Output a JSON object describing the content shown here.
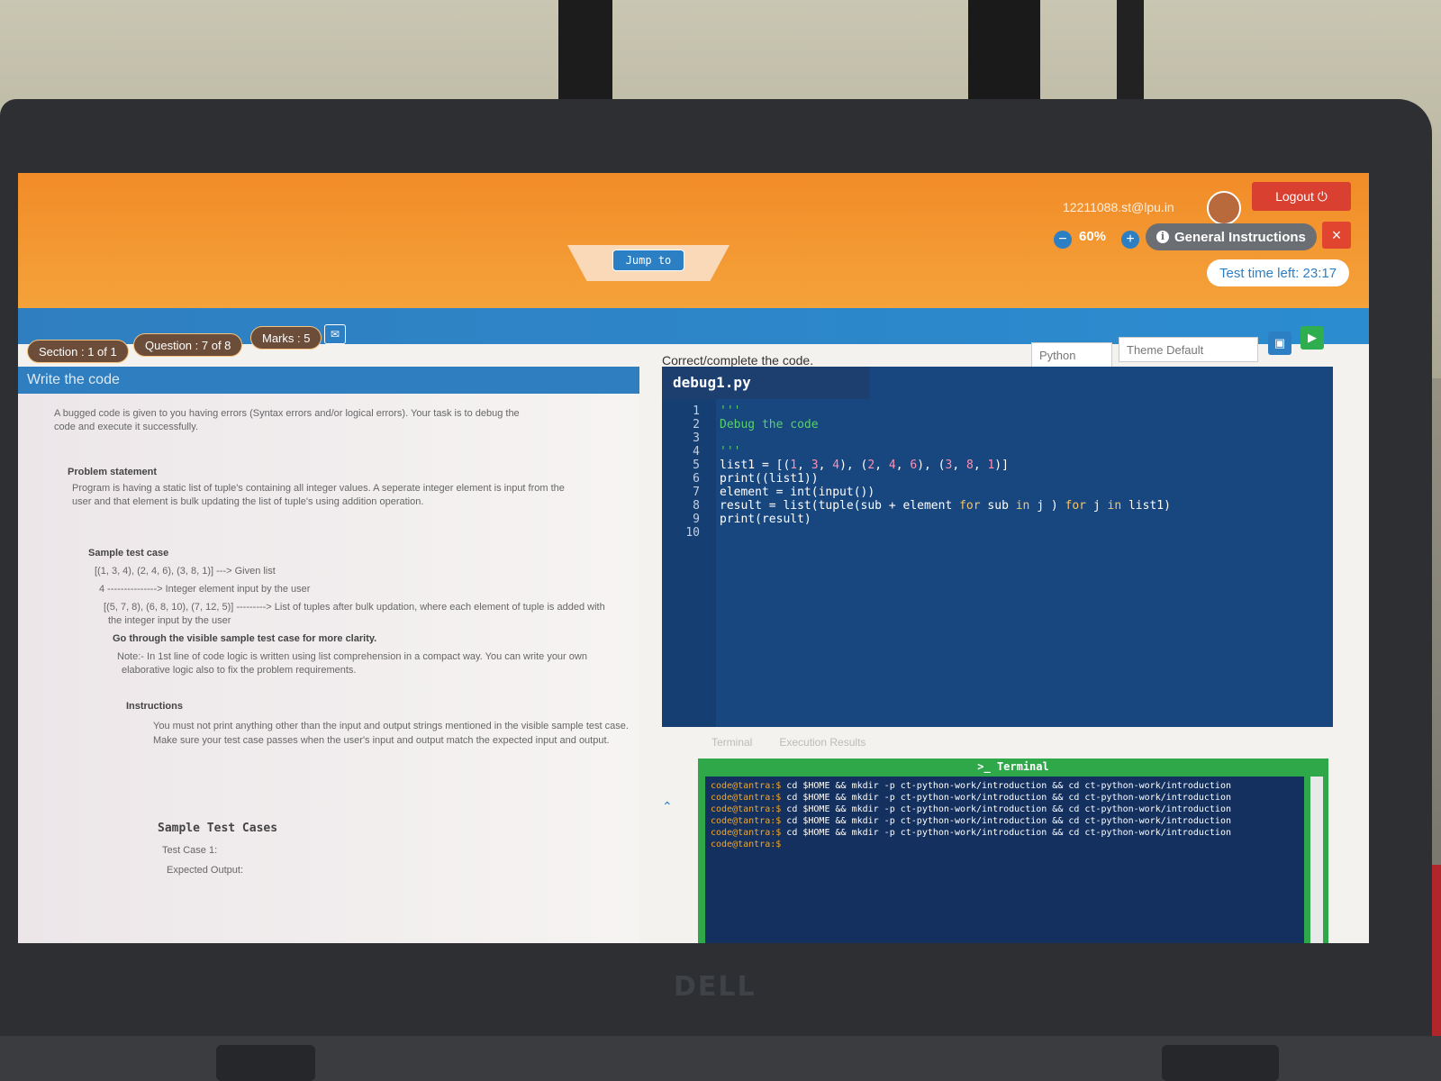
{
  "header": {
    "jump_label": "Jump to",
    "user_email": "12211088.st@lpu.in",
    "logout_label": "Logout ⏻",
    "zoom_out_symbol": "−",
    "zoom_level": "60%",
    "zoom_in_symbol": "+",
    "general_instructions_label": "General Instructions",
    "close_symbol": "×",
    "timer_text": "Test time left: 23:17"
  },
  "info_bar": {
    "section": "Section : 1 of 1",
    "question": "Question : 7 of 8",
    "marks": "Marks : 5"
  },
  "problem": {
    "title": "Write the code",
    "intro_line1": "A bugged code is given to you having errors (Syntax errors and/or logical errors). Your task is to debug the",
    "intro_line2": "code and execute it successfully.",
    "statement_heading": "Problem statement",
    "statement_line1": "Program is having a static list of tuple's containing all integer values. A seperate integer element is input from the",
    "statement_line2": "user and that element is bulk updating the list of tuple's using addition operation.",
    "sample_heading": "Sample test case",
    "sample_line1": "[(1, 3, 4), (2, 4, 6), (3, 8, 1)] ---> Given list",
    "sample_line2": "4 ---------------> Integer element input by the user",
    "sample_line3": "[(5, 7, 8), (6, 8, 10), (7, 12, 5)] ---------> List of tuples after bulk updation, where each element of tuple is added with",
    "sample_line4": "the integer input by the user",
    "visible_hint": "Go through the visible sample test case for more clarity.",
    "note_line1": "Note:- In 1st line of code logic is written using list comprehension in a compact way. You can write your own",
    "note_line2": "elaborative logic also to fix the problem requirements.",
    "instructions_heading": "Instructions",
    "instruction_1": "You must not print anything other than the input and output strings mentioned in the visible sample test case.",
    "instruction_2": "Make sure your test case passes when the user's input and output match the expected input and output.",
    "sample_cases_heading": "Sample Test Cases",
    "test_case_label": "Test Case 1:",
    "expected_output_label": "Expected Output:"
  },
  "editor": {
    "prompt": "Correct/complete the code.",
    "language": "Python",
    "theme": "Theme Default",
    "file_name": "debug1.py",
    "save_icon": "▣",
    "run_icon": "▶",
    "lines": [
      {
        "n": "1",
        "text": "'''"
      },
      {
        "n": "2",
        "text": "Debug the code"
      },
      {
        "n": "3",
        "text": ""
      },
      {
        "n": "4",
        "text": "'''"
      },
      {
        "n": "5",
        "text": "list1 = [(1, 3, 4), (2, 4, 6), (3, 8, 1)]"
      },
      {
        "n": "6",
        "text": "print((list1))"
      },
      {
        "n": "7",
        "text": "element = int(input())"
      },
      {
        "n": "8",
        "text": "result = list(tuple(sub + element for sub in j ) for j in list1)"
      },
      {
        "n": "9",
        "text": "print(result)"
      },
      {
        "n": "10",
        "text": ""
      }
    ]
  },
  "output_tabs": {
    "terminal_tab": "Terminal",
    "results_tab": "Execution Results"
  },
  "terminal": {
    "title": "Terminal",
    "icon": ">_",
    "prompt": "code@tantra:$",
    "command": "cd $HOME && mkdir -p ct-python-work/introduction && cd ct-python-work/introduction",
    "repeat_count_visible": 5
  },
  "device": {
    "brand": "DELL"
  }
}
